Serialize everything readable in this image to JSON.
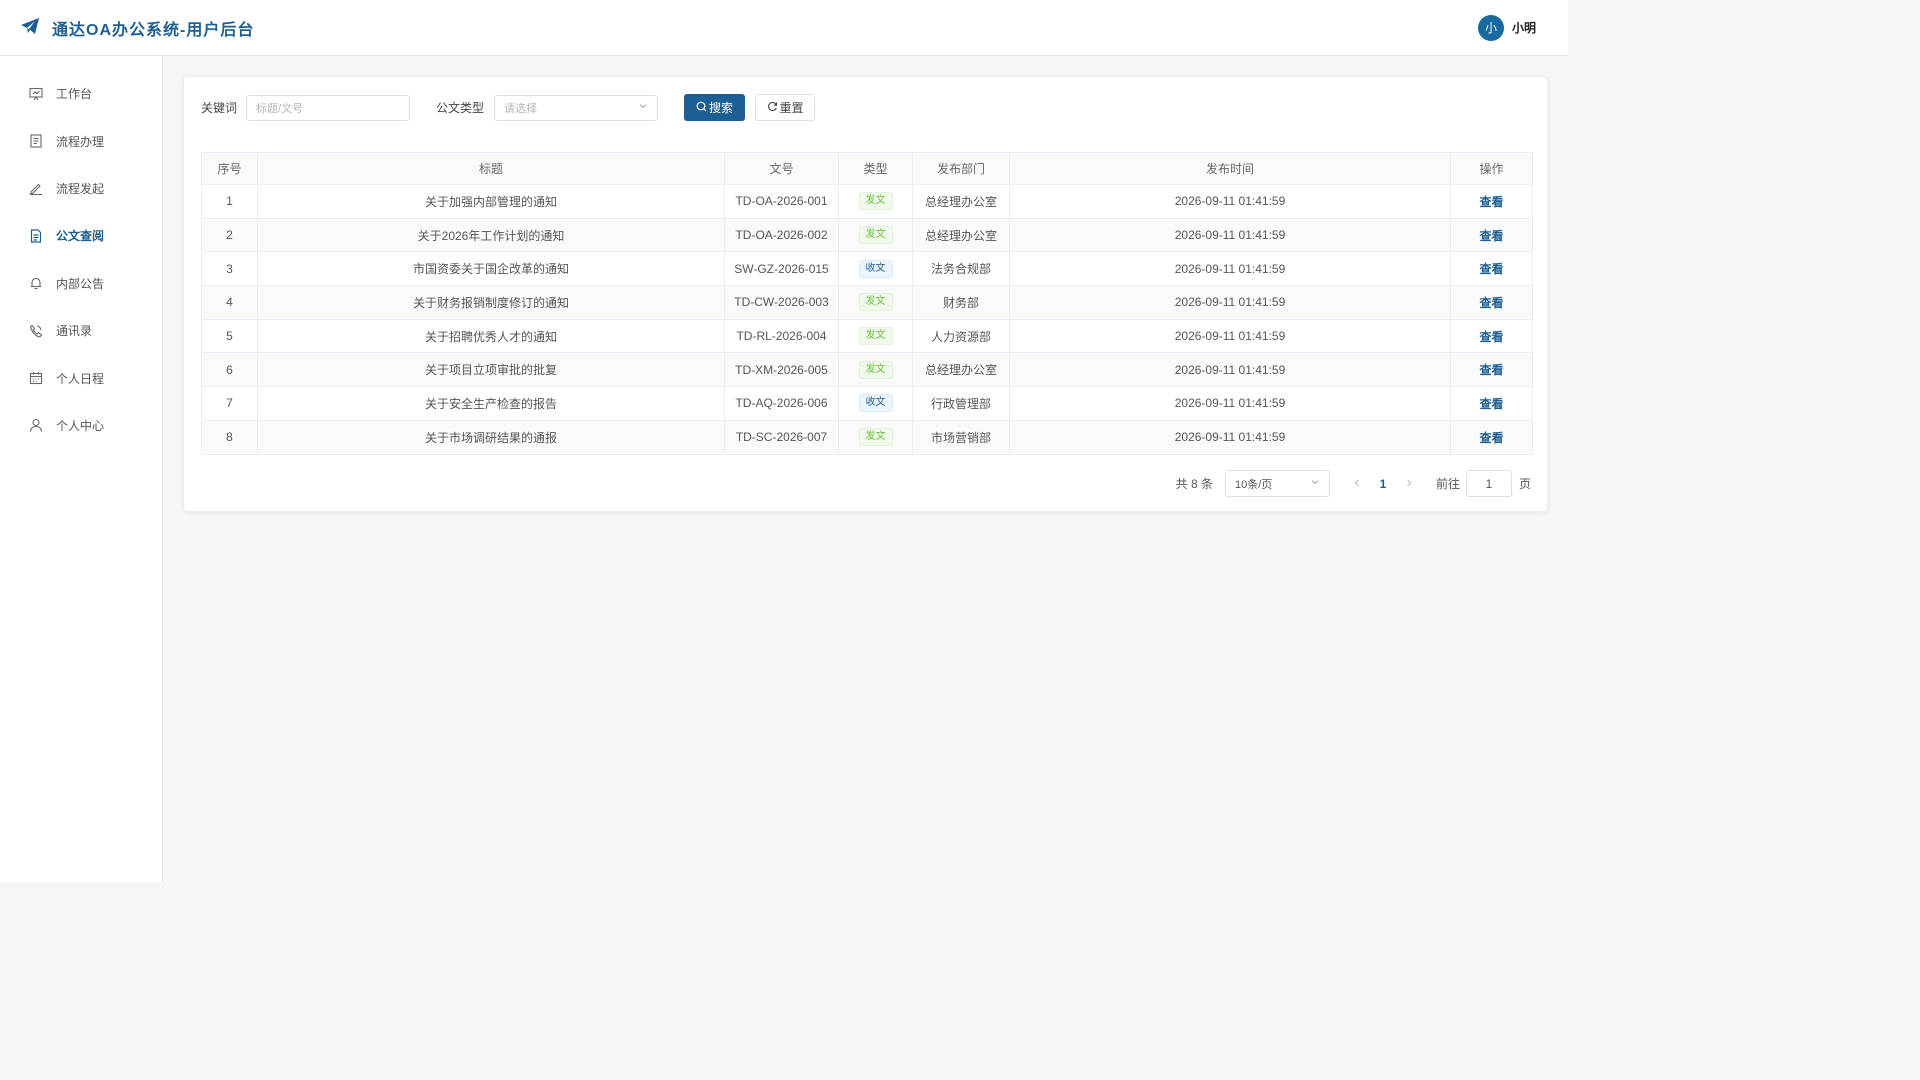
{
  "header": {
    "title": "通达OA办公系统-用户后台",
    "user_avatar_char": "小",
    "user_name": "小明",
    "brand_color": "#1d5f95"
  },
  "sidebar": {
    "items": [
      {
        "label": "工作台",
        "icon": "dashboard-icon",
        "active": false
      },
      {
        "label": "流程办理",
        "icon": "document-list-icon",
        "active": false
      },
      {
        "label": "流程发起",
        "icon": "pen-icon",
        "active": false
      },
      {
        "label": "公文查阅",
        "icon": "document-icon",
        "active": true
      },
      {
        "label": "内部公告",
        "icon": "bell-icon",
        "active": false
      },
      {
        "label": "通讯录",
        "icon": "phone-icon",
        "active": false
      },
      {
        "label": "个人日程",
        "icon": "calendar-icon",
        "active": false
      },
      {
        "label": "个人中心",
        "icon": "user-icon",
        "active": false
      }
    ]
  },
  "filters": {
    "keyword_label": "关键词",
    "keyword_placeholder": "标题/文号",
    "type_label": "公文类型",
    "type_placeholder": "请选择",
    "search_label": "搜索",
    "reset_label": "重置"
  },
  "table": {
    "headers": [
      "序号",
      "标题",
      "文号",
      "类型",
      "发布部门",
      "发布时间",
      "操作"
    ],
    "rows": [
      {
        "no": "1",
        "title": "关于加强内部管理的通知",
        "code": "TD-OA-2026-001",
        "type": "发文",
        "dept": "总经理办公室",
        "time": "2026-09-11 01:41:59",
        "action": "查看"
      },
      {
        "no": "2",
        "title": "关于2026年工作计划的通知",
        "code": "TD-OA-2026-002",
        "type": "发文",
        "dept": "总经理办公室",
        "time": "2026-09-11 01:41:59",
        "action": "查看"
      },
      {
        "no": "3",
        "title": "市国资委关于国企改革的通知",
        "code": "SW-GZ-2026-015",
        "type": "收文",
        "dept": "法务合规部",
        "time": "2026-09-11 01:41:59",
        "action": "查看"
      },
      {
        "no": "4",
        "title": "关于财务报销制度修订的通知",
        "code": "TD-CW-2026-003",
        "type": "发文",
        "dept": "财务部",
        "time": "2026-09-11 01:41:59",
        "action": "查看"
      },
      {
        "no": "5",
        "title": "关于招聘优秀人才的通知",
        "code": "TD-RL-2026-004",
        "type": "发文",
        "dept": "人力资源部",
        "time": "2026-09-11 01:41:59",
        "action": "查看"
      },
      {
        "no": "6",
        "title": "关于项目立项审批的批复",
        "code": "TD-XM-2026-005",
        "type": "发文",
        "dept": "总经理办公室",
        "time": "2026-09-11 01:41:59",
        "action": "查看"
      },
      {
        "no": "7",
        "title": "关于安全生产检查的报告",
        "code": "TD-AQ-2026-006",
        "type": "收文",
        "dept": "行政管理部",
        "time": "2026-09-11 01:41:59",
        "action": "查看"
      },
      {
        "no": "8",
        "title": "关于市场调研结果的通报",
        "code": "TD-SC-2026-007",
        "type": "发文",
        "dept": "市场营销部",
        "time": "2026-09-11 01:41:59",
        "action": "查看"
      }
    ]
  },
  "pagination": {
    "total": "共 8 条",
    "page_size": "10条/页",
    "current_page": "1",
    "goto_label": "前往",
    "goto_value": "1",
    "page_suffix": "页"
  }
}
